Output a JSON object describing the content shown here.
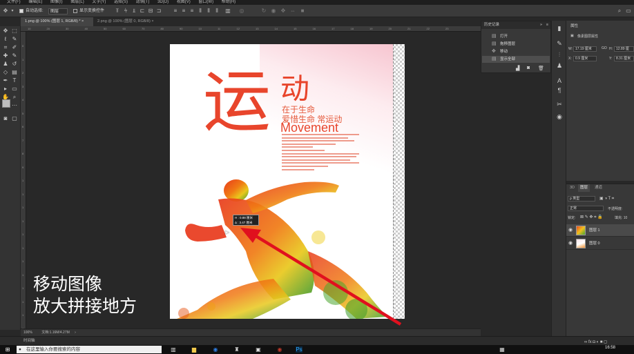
{
  "menu": [
    "文件(F)",
    "编辑(E)",
    "图像(I)",
    "图层(L)",
    "文字(Y)",
    "选择(S)",
    "滤镜(T)",
    "3D(D)",
    "视图(V)",
    "窗口(W)",
    "帮助(H)"
  ],
  "options": {
    "auto_select_label": "自动选择:",
    "auto_select_value": "图层",
    "show_transform_label": "显示变换控件"
  },
  "tabs": [
    {
      "label": "1.png @ 100% (图层 1, RGB/8) *",
      "close": "×"
    },
    {
      "label": "2.png @ 100% (图层 0, RGB/8)",
      "close": "×"
    }
  ],
  "ruler_h": [
    "10",
    "20",
    "30",
    "40",
    "50",
    "60",
    "70",
    "80",
    "90",
    "10",
    "11",
    "12",
    "13",
    "14",
    "15",
    "16",
    "17",
    "18",
    "19",
    "20",
    "21",
    "22",
    "23"
  ],
  "ruler_v": [
    "0",
    "1",
    "2",
    "3",
    "4",
    "5",
    "6",
    "7",
    "8",
    "9",
    "1",
    "1",
    "1",
    "1",
    "1",
    "1",
    "1",
    "1",
    "1",
    "1",
    "1",
    "1"
  ],
  "poster": {
    "big_char": "运",
    "char2": "动",
    "slogan1": "在于生命",
    "slogan2": "爱惜生命 常运动",
    "movement": "Movement"
  },
  "size_tooltip": {
    "w": "H : 0.88 厘米",
    "h": "Δ : 3.47 厘米"
  },
  "caption": {
    "line1": "移动图像",
    "line2": "放大拼接地方"
  },
  "status": {
    "zoom": "100%",
    "doc": "文档:1.16M/4.27M"
  },
  "timeline_label": "时间轴",
  "history": {
    "title": "历史记录",
    "items": [
      "打开",
      "拖移图层",
      "移动",
      "显示全部"
    ]
  },
  "properties": {
    "title": "属性",
    "subtitle": "像素图层属性",
    "w_label": "W:",
    "w_value": "17.19 厘米",
    "link": "GO",
    "h_label": "H:",
    "h_value": "12.89 厘",
    "x_label": "X:",
    "x_value": "0.9 厘米",
    "y_label": "Y:",
    "y_value": "8.31 厘米"
  },
  "layers": {
    "tabs": [
      "3D",
      "图层",
      "通道"
    ],
    "kind_label": "ρ 类型",
    "blend": "正常",
    "opacity_label": "不透明度:",
    "lock_label": "锁定:",
    "fill_label": "填充: 10",
    "rows": [
      {
        "name": "图层 1",
        "selected": true
      },
      {
        "name": "图层 0",
        "selected": false
      }
    ],
    "footer_icons": "∞ fx ◘ ◐ ■ ◻"
  },
  "taskbar": {
    "search_placeholder": "在这里输入你要搜索的内容",
    "time": "16:58"
  },
  "colors": {
    "accent_red": "#e8452c",
    "arrow_red": "#e0101e"
  }
}
